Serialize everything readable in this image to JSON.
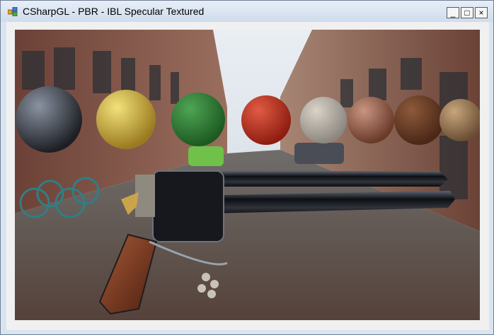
{
  "window": {
    "title": "CSharpGL - PBR - IBL Specular Textured",
    "controls": {
      "minimize": "_",
      "maximize": "□",
      "close": "×"
    }
  },
  "scene": {
    "spheres": [
      {
        "name": "sphere-black-metal",
        "color": "#1d1f24",
        "hl": "#8a93a2"
      },
      {
        "name": "sphere-gold",
        "color": "#9a7a20",
        "hl": "#f2e27a"
      },
      {
        "name": "sphere-green-grass",
        "color": "#1d5a22",
        "hl": "#4fa554"
      },
      {
        "name": "sphere-red-plastic",
        "color": "#8e1d10",
        "hl": "#e15b44"
      },
      {
        "name": "sphere-rock",
        "color": "#8c8780",
        "hl": "#d9d3c8"
      },
      {
        "name": "sphere-rusted-metal",
        "color": "#6a3a28",
        "hl": "#c99583"
      },
      {
        "name": "sphere-wood",
        "color": "#4a2717",
        "hl": "#8d5a3a"
      },
      {
        "name": "sphere-brushed-metal",
        "color": "#6b4f35",
        "hl": "#c7a67c"
      }
    ]
  }
}
